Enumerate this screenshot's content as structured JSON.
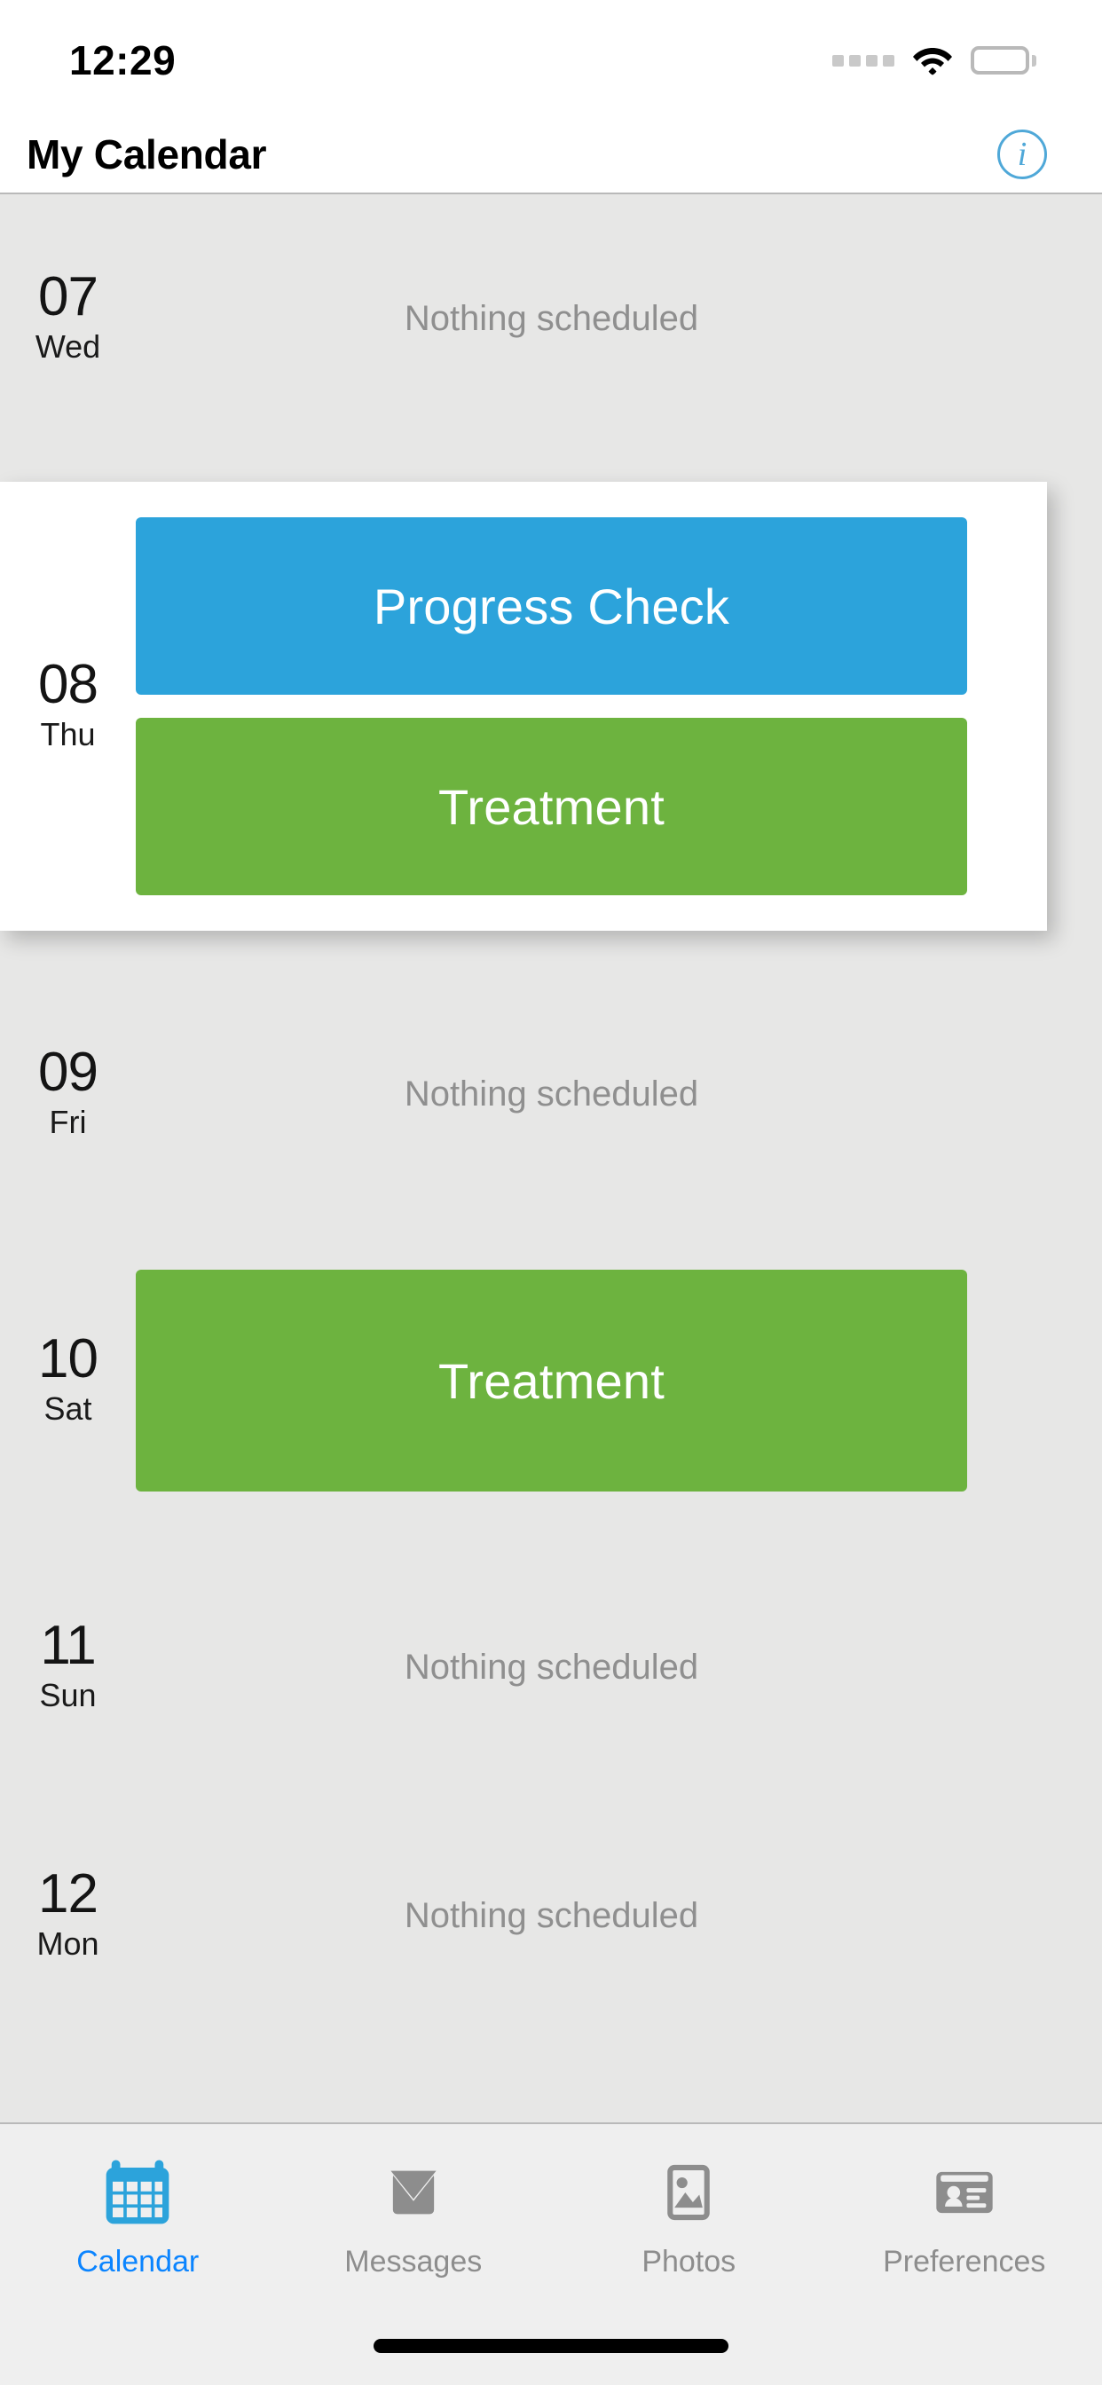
{
  "status_bar": {
    "time": "12:29",
    "signal_icon": "signal-dots-icon",
    "wifi_icon": "wifi-icon",
    "battery_icon": "battery-full-icon"
  },
  "nav": {
    "title": "My Calendar",
    "info_icon": "info-circle-icon",
    "info_label": "i",
    "accent_color": "#4fa8d8"
  },
  "colors": {
    "page_background": "#e7e7e6",
    "card_background": "#ffffff",
    "event_blue": "#2ca3db",
    "event_green": "#6db33f",
    "muted_text": "#8f8f8f",
    "tab_active": "#0a84ff",
    "tab_inactive": "#8d8d8d"
  },
  "days": [
    {
      "date": "07",
      "weekday": "Wed",
      "highlighted": false,
      "empty_text": "Nothing scheduled",
      "events": []
    },
    {
      "date": "08",
      "weekday": "Thu",
      "highlighted": true,
      "empty_text": "",
      "events": [
        {
          "title": "Progress Check",
          "color": "#2ca3db"
        },
        {
          "title": "Treatment",
          "color": "#6db33f"
        }
      ]
    },
    {
      "date": "09",
      "weekday": "Fri",
      "highlighted": false,
      "empty_text": "Nothing scheduled",
      "events": []
    },
    {
      "date": "10",
      "weekday": "Sat",
      "highlighted": false,
      "empty_text": "",
      "events": [
        {
          "title": "Treatment",
          "color": "#6db33f"
        }
      ]
    },
    {
      "date": "11",
      "weekday": "Sun",
      "highlighted": false,
      "empty_text": "Nothing scheduled",
      "events": []
    },
    {
      "date": "12",
      "weekday": "Mon",
      "highlighted": false,
      "empty_text": "Nothing scheduled",
      "events": []
    }
  ],
  "tab_bar": {
    "items": [
      {
        "label": "Calendar",
        "icon": "calendar-icon",
        "active": true
      },
      {
        "label": "Messages",
        "icon": "envelope-icon",
        "active": false
      },
      {
        "label": "Photos",
        "icon": "photo-icon",
        "active": false
      },
      {
        "label": "Preferences",
        "icon": "contact-card-icon",
        "active": false
      }
    ]
  }
}
